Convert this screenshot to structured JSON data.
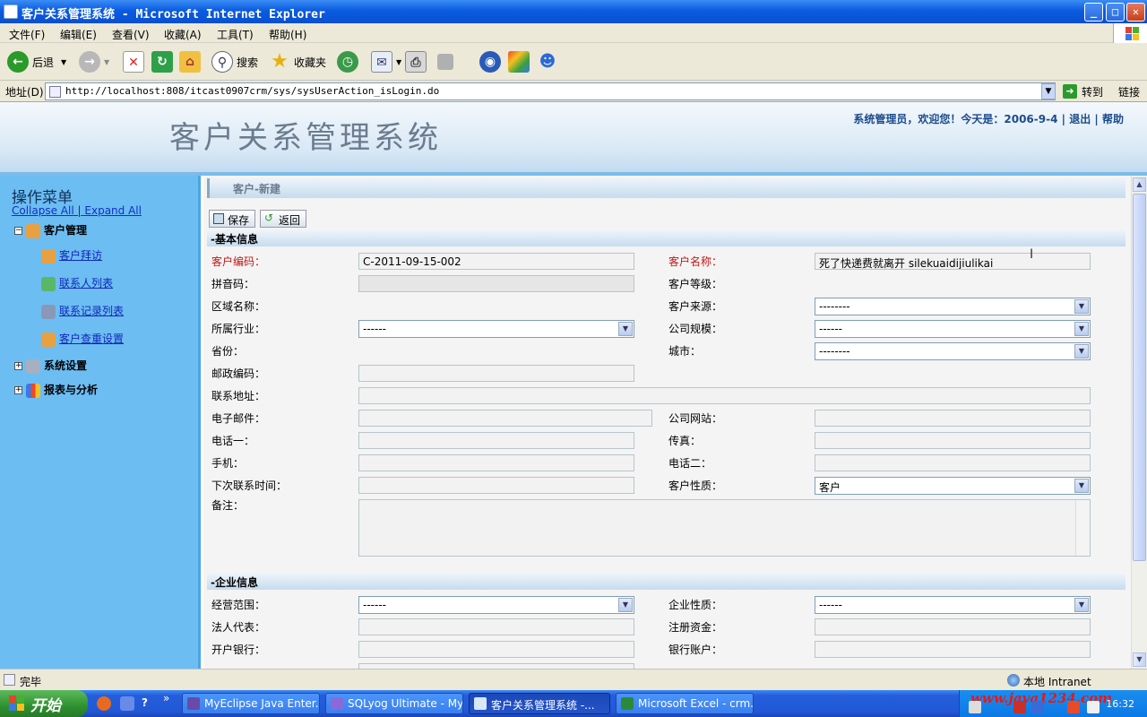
{
  "window": {
    "title": "客户关系管理系统 - Microsoft Internet Explorer",
    "min": "_",
    "max": "□",
    "close": "✕"
  },
  "menu": [
    "文件(F)",
    "编辑(E)",
    "查看(V)",
    "收藏(A)",
    "工具(T)",
    "帮助(H)"
  ],
  "toolbar": {
    "back": "后退",
    "search": "搜索",
    "favorites": "收藏夹"
  },
  "address": {
    "label": "地址(D)",
    "url": "http://localhost:808/itcast0907crm/sys/sysUserAction_isLogin.do",
    "go": "转到",
    "links": "链接"
  },
  "header": {
    "system_name": "客户关系管理系统",
    "welcome": "系统管理员，欢迎您！今天是：2006-9-4",
    "logout": "退出",
    "help": "帮助",
    "sep": "|"
  },
  "sidebar": {
    "title": "操作菜单",
    "collapse_all": "Collapse All",
    "sep": "|",
    "expand_all": "Expand All",
    "customer_mgmt": "客户管理",
    "visit": "客户拜访",
    "contacts": "联系人列表",
    "records": "联系记录列表",
    "dup_settings": "客户查重设置",
    "sys_settings": "系统设置",
    "reports": "报表与分析"
  },
  "page": {
    "breadcrumb": "客户-新建",
    "save": "保存",
    "back": "返回",
    "basic_section": "-基本信息",
    "enterprise_section": "-企业信息"
  },
  "form": {
    "code_label": "客户编码：",
    "code_value": "C-2011-09-15-002",
    "name_label": "客户名称：",
    "name_value": "死了快递费就离开 silekuaidijiulikai",
    "pinyin_label": "拼音码：",
    "grade_label": "客户等级：",
    "region_label": "区域名称：",
    "source_label": "客户来源：",
    "source_value": "--------",
    "industry_label": "所属行业：",
    "industry_value": "------",
    "scale_label": "公司规模：",
    "scale_value": "------",
    "province_label": "省份：",
    "city_label": "城市：",
    "city_value": "--------",
    "postcode_label": "邮政编码：",
    "address_label": "联系地址：",
    "email_label": "电子邮件：",
    "website_label": "公司网站：",
    "phone1_label": "电话一：",
    "fax_label": "传真：",
    "mobile_label": "手机：",
    "phone2_label": "电话二：",
    "next_contact_label": "下次联系时间：",
    "nature_label": "客户性质：",
    "nature_value": "客户",
    "remarks_label": "备注：",
    "biz_scope_label": "经营范围：",
    "biz_scope_value": "------",
    "ent_nature_label": "企业性质：",
    "ent_nature_value": "------",
    "legal_rep_label": "法人代表：",
    "reg_capital_label": "注册资金：",
    "bank_label": "开户银行：",
    "account_label": "银行账户："
  },
  "status": {
    "text": "完毕",
    "zone": "本地 Intranet"
  },
  "taskbar": {
    "start": "开始",
    "tasks": [
      "MyEclipse Java Enter...",
      "SQLyog Ultimate - My...",
      "客户关系管理系统 -...",
      "Microsoft Excel - crm..."
    ],
    "watermark": "www.java1234.com",
    "clock": "16:32"
  },
  "colors": {
    "sidebar": "#6cbdf2",
    "title_bar": "#0a5ce0",
    "required_label": "#c01818"
  }
}
